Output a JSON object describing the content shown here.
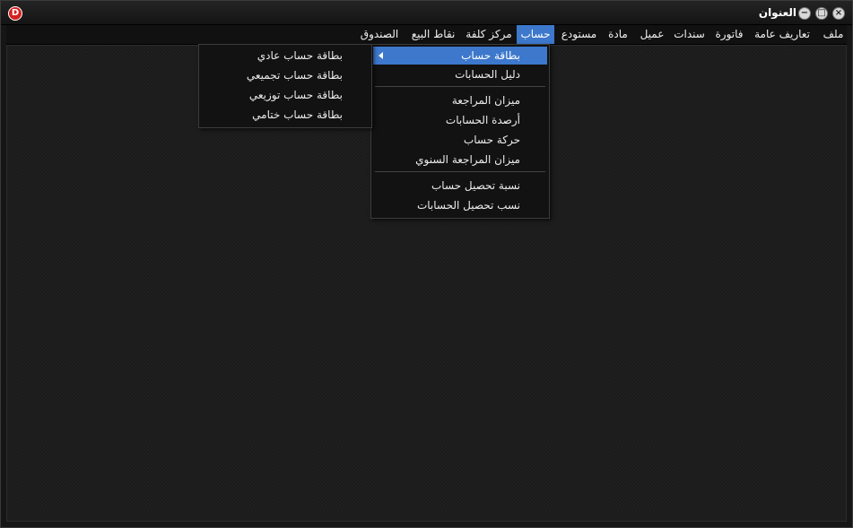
{
  "window": {
    "title": "العنوان",
    "logo": "D",
    "buttons": {
      "close": "×",
      "maximize": "□",
      "minimize": "−"
    }
  },
  "menubar": {
    "items": [
      {
        "label": "ملف"
      },
      {
        "label": "تعاريف عامة"
      },
      {
        "label": "فاتورة"
      },
      {
        "label": "سندات"
      },
      {
        "label": "عميل"
      },
      {
        "label": "مادة"
      },
      {
        "label": "مستودع"
      },
      {
        "label": "حساب",
        "active": true
      },
      {
        "label": "مركز كلفة"
      },
      {
        "label": "نقاط البيع"
      },
      {
        "label": "الصندوق"
      }
    ]
  },
  "account_menu": {
    "items": [
      {
        "label": "بطاقة حساب",
        "highlight": true,
        "has_submenu": true
      },
      {
        "label": "دليل الحسابات"
      },
      {
        "label": "ميزان المراجعة"
      },
      {
        "label": "أرصدة الحسابات"
      },
      {
        "label": "حركة حساب"
      },
      {
        "label": "ميزان المراجعة السنوي"
      },
      {
        "label": "نسبة تحصيل حساب"
      },
      {
        "label": "نسب تحصيل الحسابات"
      }
    ]
  },
  "account_card_submenu": {
    "items": [
      {
        "label": "بطاقة حساب عادي"
      },
      {
        "label": "بطاقة حساب تجميعي"
      },
      {
        "label": "بطاقة حساب توزيعي"
      },
      {
        "label": "بطاقة حساب ختامي"
      }
    ]
  },
  "colors": {
    "accent": "#3d78cc",
    "background": "#1b1b1b",
    "logo": "#d62020"
  },
  "icons": {
    "logo": "app-logo-icon",
    "close": "close-icon",
    "maximize": "maximize-icon",
    "minimize": "minimize-icon",
    "submenu": "submenu-arrow-icon"
  }
}
